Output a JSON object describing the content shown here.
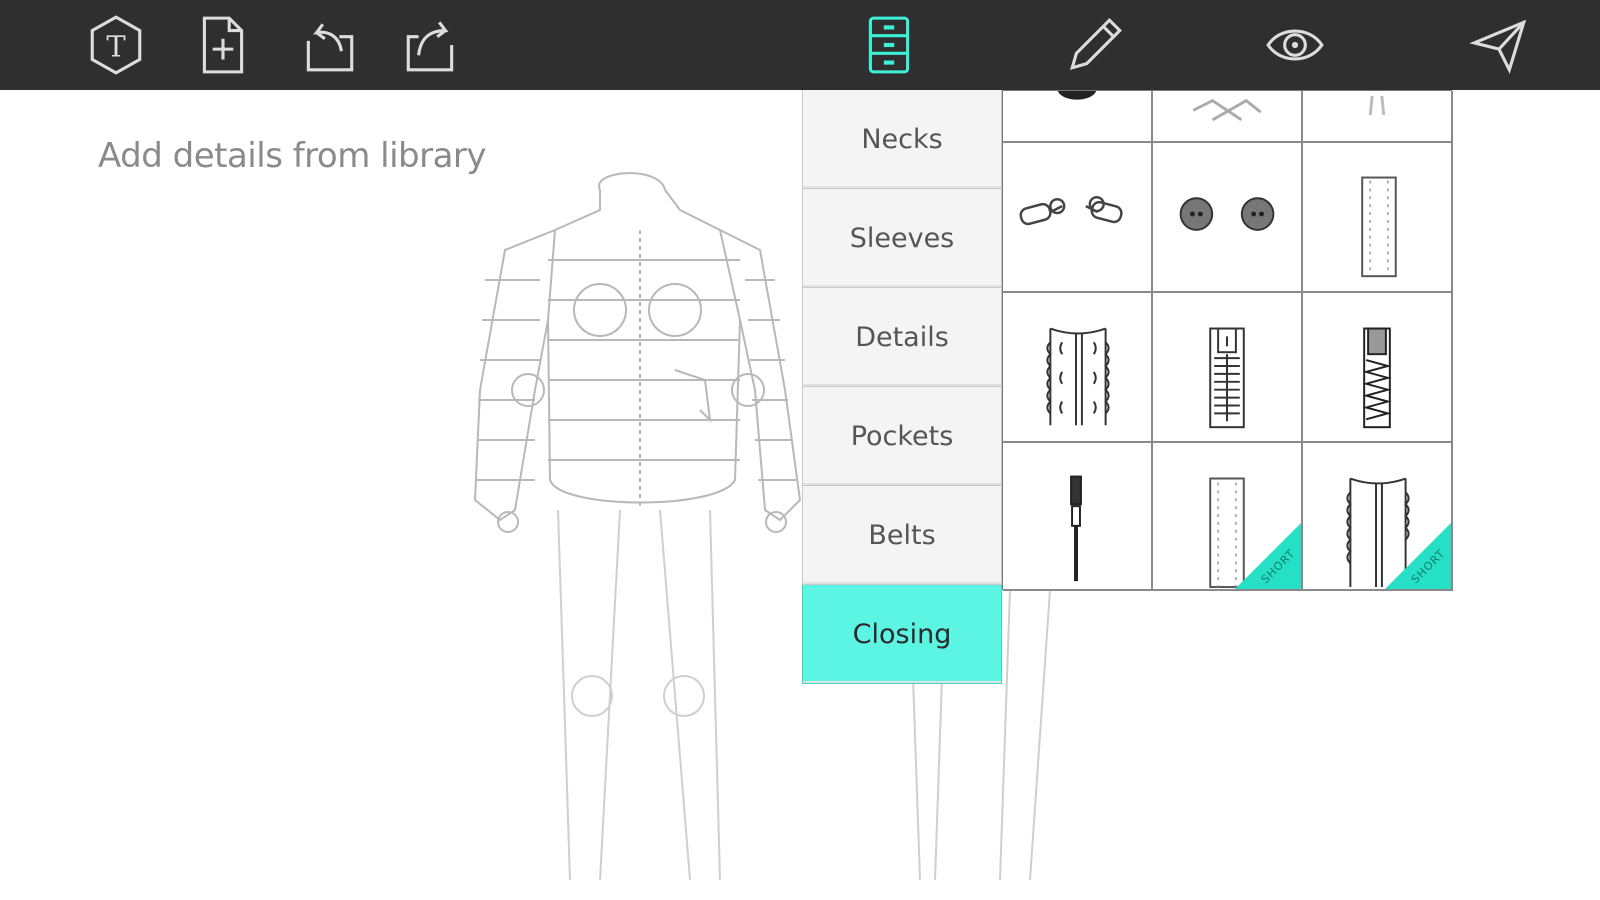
{
  "toolbar": {
    "items": [
      {
        "name": "logo-icon"
      },
      {
        "name": "new-file-icon"
      },
      {
        "name": "undo-icon"
      },
      {
        "name": "redo-icon"
      },
      {
        "name": "library-icon",
        "active": true
      },
      {
        "name": "pencil-icon"
      },
      {
        "name": "eye-icon"
      },
      {
        "name": "send-icon"
      }
    ],
    "active_color": "#3df0d8"
  },
  "canvas": {
    "hint": "Add details from library"
  },
  "library": {
    "categories": [
      {
        "label": "Necks"
      },
      {
        "label": "Sleeves"
      },
      {
        "label": "Details"
      },
      {
        "label": "Pockets"
      },
      {
        "label": "Belts"
      },
      {
        "label": "Closing",
        "active": true
      }
    ],
    "items": [
      {
        "name": "closing-item-1"
      },
      {
        "name": "closing-item-2"
      },
      {
        "name": "closing-item-3"
      },
      {
        "name": "toggle-closure-item"
      },
      {
        "name": "button-pair-item"
      },
      {
        "name": "stitched-placket-item"
      },
      {
        "name": "ruffled-zipper-item"
      },
      {
        "name": "toothed-zipper-item"
      },
      {
        "name": "coil-zipper-item"
      },
      {
        "name": "zipper-pull-item"
      },
      {
        "name": "short-placket-item",
        "badge": "SHORT"
      },
      {
        "name": "short-ruffled-zipper-item",
        "badge": "SHORT"
      }
    ],
    "accent": "#5cf4e2"
  }
}
